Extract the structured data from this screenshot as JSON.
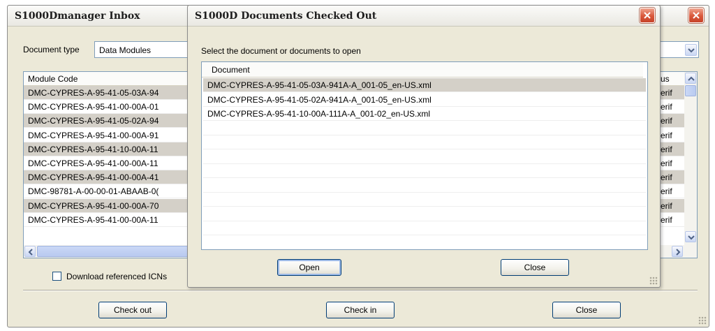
{
  "inbox": {
    "title": "S1000Dmanager Inbox",
    "doctype_label": "Document type",
    "doctype_value": "Data Modules",
    "col_module_code": "Module Code",
    "col_status": "us",
    "rows": [
      {
        "code": "DMC-CYPRES-A-95-41-05-03A-94",
        "status": "erif"
      },
      {
        "code": "DMC-CYPRES-A-95-41-00-00A-01",
        "status": "erif"
      },
      {
        "code": "DMC-CYPRES-A-95-41-05-02A-94",
        "status": "erif"
      },
      {
        "code": "DMC-CYPRES-A-95-41-00-00A-91",
        "status": "erif"
      },
      {
        "code": "DMC-CYPRES-A-95-41-10-00A-11",
        "status": "erif"
      },
      {
        "code": "DMC-CYPRES-A-95-41-00-00A-11",
        "status": "erif"
      },
      {
        "code": "DMC-CYPRES-A-95-41-00-00A-41",
        "status": "erif"
      },
      {
        "code": "DMC-98781-A-00-00-01-ABAAB-0(",
        "status": "erif"
      },
      {
        "code": "DMC-CYPRES-A-95-41-00-00A-70",
        "status": "erif"
      },
      {
        "code": "DMC-CYPRES-A-95-41-00-00A-11",
        "status": "erif"
      }
    ],
    "download_label": "Download referenced ICNs",
    "btn_checkout": "Check out",
    "btn_checkin": "Check in",
    "btn_close": "Close"
  },
  "dialog": {
    "title": "S1000D Documents Checked Out",
    "instruction": "Select the document or documents to open",
    "col_document": "Document",
    "rows": [
      "DMC-CYPRES-A-95-41-05-03A-941A-A_001-05_en-US.xml",
      "DMC-CYPRES-A-95-41-05-02A-941A-A_001-05_en-US.xml",
      "DMC-CYPRES-A-95-41-10-00A-111A-A_001-02_en-US.xml"
    ],
    "btn_open": "Open",
    "btn_close": "Close"
  }
}
